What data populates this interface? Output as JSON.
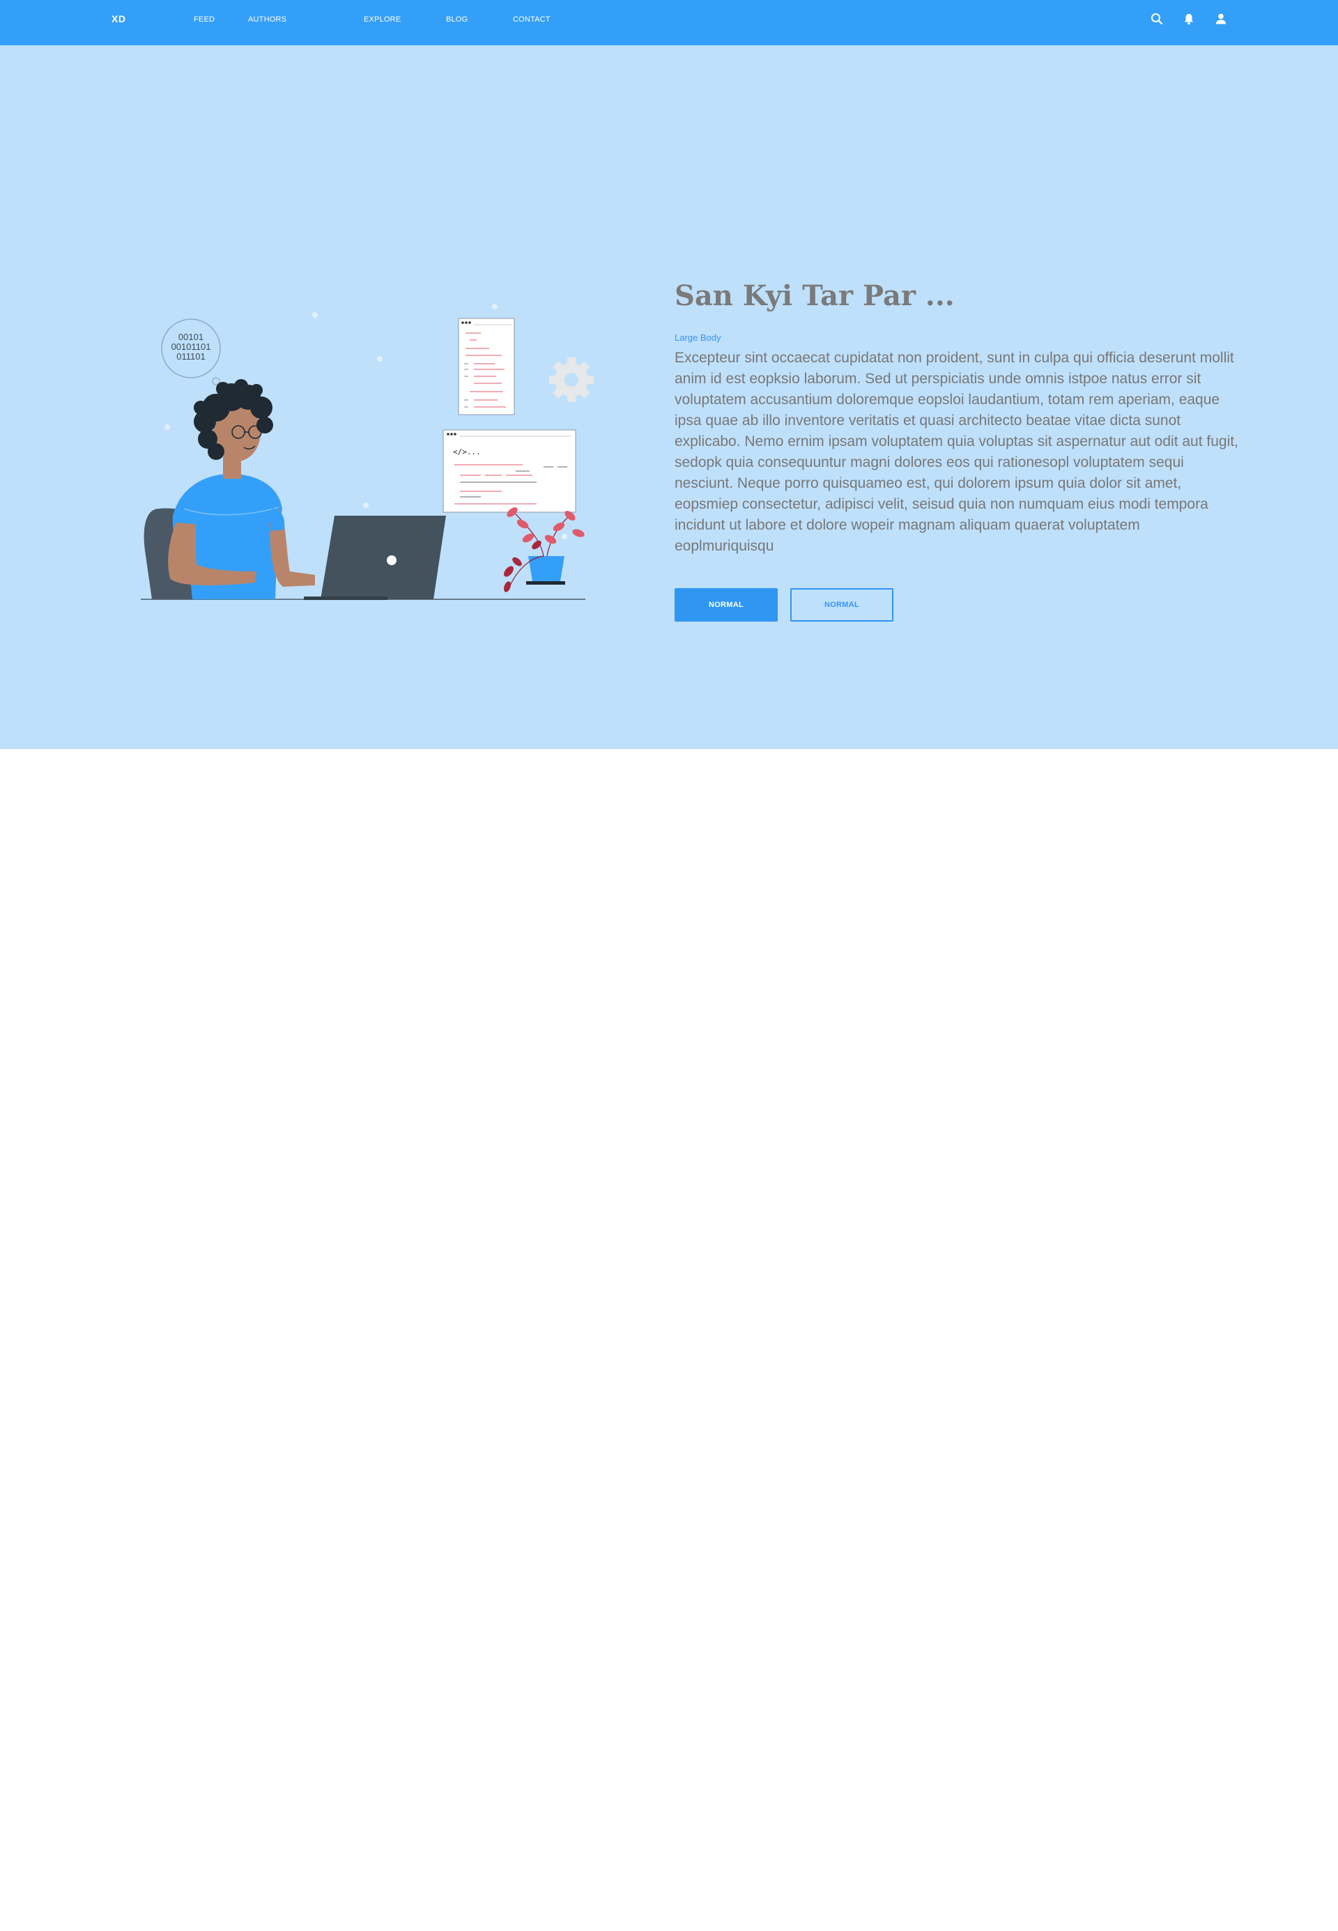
{
  "navbar": {
    "logo": "XD",
    "links": [
      "FEED",
      "AUTHORS",
      "EXPLORE",
      "BLOG",
      "CONTACT"
    ],
    "icons": [
      "search-icon",
      "bell-icon",
      "user-icon"
    ],
    "background": "#349ff8"
  },
  "hero": {
    "background": "#bfe0fb",
    "title": "San Kyi Tar Par ...",
    "eyebrow": "Large Body",
    "body": "Excepteur sint occaecat cupidatat non proident, sunt in culpa qui officia deserunt mollit anim id est eopksio laborum. Sed ut perspiciatis unde omnis istpoe natus error sit voluptatem accusantium doloremque eopsloi laudantium, totam rem aperiam, eaque ipsa quae ab illo inventore veritatis et quasi architecto beatae vitae dicta sunot explicabo. Nemo ernim ipsam voluptatem quia voluptas sit aspernatur aut odit aut fugit, sedopk quia consequuntur magni dolores eos qui rationesopl voluptatem sequi nesciunt. Neque porro quisquameo est, qui dolorem ipsum quia dolor sit amet, eopsmiep consectetur, adipisci velit, seisud quia non numquam eius modi tempora incidunt ut labore et dolore wopeir magnam aliquam quaerat voluptatem eoplmuriquisqu",
    "primary_button": "NORMAL",
    "secondary_button": "NORMAL",
    "accent": "#2f96f2",
    "illustration": {
      "binary_lines": [
        "00101",
        "00101101",
        "011101"
      ],
      "code_tag": "</>..."
    }
  }
}
